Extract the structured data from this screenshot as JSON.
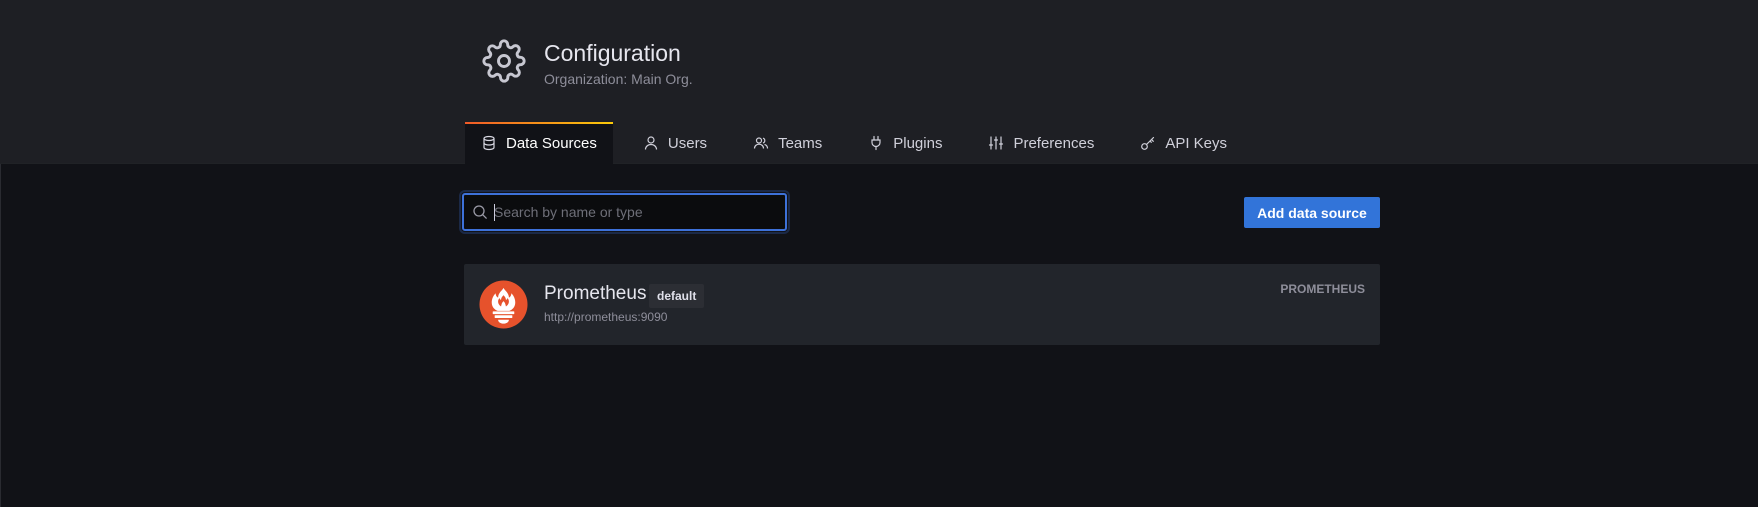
{
  "header": {
    "title": "Configuration",
    "subtitle": "Organization: Main Org.",
    "icon": "gear-icon"
  },
  "tabs": [
    {
      "label": "Data Sources",
      "icon": "database-icon",
      "active": true
    },
    {
      "label": "Users",
      "icon": "user-icon",
      "active": false
    },
    {
      "label": "Teams",
      "icon": "users-icon",
      "active": false
    },
    {
      "label": "Plugins",
      "icon": "plug-icon",
      "active": false
    },
    {
      "label": "Preferences",
      "icon": "sliders-icon",
      "active": false
    },
    {
      "label": "API Keys",
      "icon": "key-icon",
      "active": false
    }
  ],
  "search": {
    "placeholder": "Search by name or type",
    "value": ""
  },
  "actions": {
    "add_label": "Add data source"
  },
  "datasources": [
    {
      "name": "Prometheus",
      "badge": "default",
      "url": "http://prometheus:9090",
      "type": "PROMETHEUS",
      "logo": "prometheus-logo"
    }
  ],
  "colors": {
    "accent_blue": "#3274d9",
    "tab_gradient_start": "#f05a28",
    "tab_gradient_end": "#fbca0a",
    "prometheus_orange": "#e6522c"
  }
}
